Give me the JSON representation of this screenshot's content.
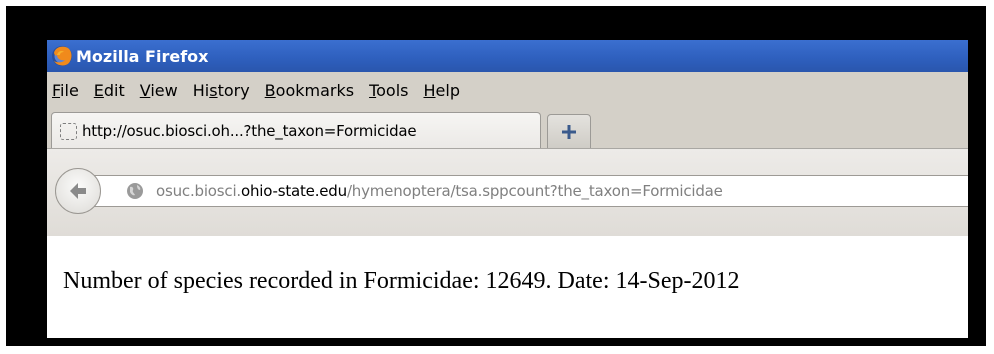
{
  "window": {
    "title": "Mozilla Firefox"
  },
  "menu": {
    "items": [
      {
        "pre": "",
        "key": "F",
        "post": "ile"
      },
      {
        "pre": "",
        "key": "E",
        "post": "dit"
      },
      {
        "pre": "",
        "key": "V",
        "post": "iew"
      },
      {
        "pre": "Hi",
        "key": "s",
        "post": "tory"
      },
      {
        "pre": "",
        "key": "B",
        "post": "ookmarks"
      },
      {
        "pre": "",
        "key": "T",
        "post": "ools"
      },
      {
        "pre": "",
        "key": "H",
        "post": "elp"
      }
    ]
  },
  "tabs": {
    "active_label": "http://osuc.biosci.oh...?the_taxon=Formicidae",
    "new_tab_icon": "plus-icon"
  },
  "urlbar": {
    "prefix": "osuc.biosci.",
    "domain": "ohio-state.edu",
    "path": "/hymenoptera/tsa.sppcount?the_taxon=Formicidae"
  },
  "page": {
    "text": "Number of species recorded in Formicidae: 12649. Date: 14-Sep-2012"
  },
  "colors": {
    "titlebar": "#2e5fbd",
    "chrome": "#d4d0c8"
  }
}
